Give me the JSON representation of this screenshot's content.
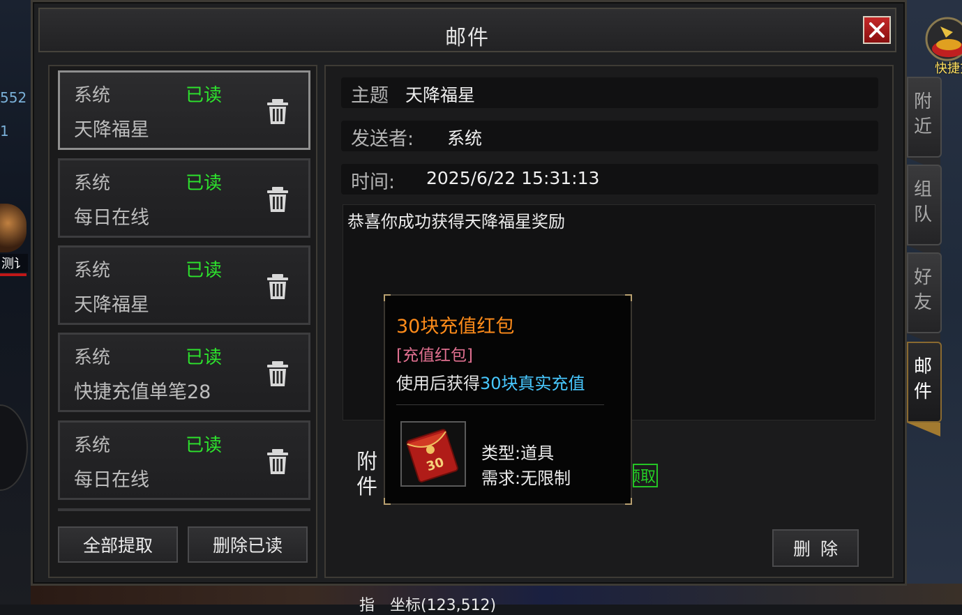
{
  "window": {
    "title": "邮件"
  },
  "left_bg": {
    "num1": "552",
    "num2": "1",
    "name": "测讠"
  },
  "mail_list": [
    {
      "sender": "系统",
      "status": "已读",
      "subject": "天降福星"
    },
    {
      "sender": "系统",
      "status": "已读",
      "subject": "每日在线"
    },
    {
      "sender": "系统",
      "status": "已读",
      "subject": "天降福星"
    },
    {
      "sender": "系统",
      "status": "已读",
      "subject": "快捷充值单笔28"
    },
    {
      "sender": "系统",
      "status": "已读",
      "subject": "每日在线"
    }
  ],
  "buttons": {
    "claim_all": "全部提取",
    "delete_read": "删除已读",
    "delete": "删除",
    "receive": "领取"
  },
  "detail": {
    "subject_label": "主题",
    "subject": "天降福星",
    "sender_label": "发送者:",
    "sender": "系统",
    "time_label": "时间:",
    "time": "2025/6/22 15:31:13",
    "body": "恭喜你成功获得天降福星奖励",
    "attachment_label": "附件"
  },
  "tooltip": {
    "name": "30块充值红包",
    "category": "[充值红包]",
    "desc_prefix": "使用后获得",
    "desc_highlight": "30块真实充值",
    "type": "类型:道具",
    "requirement": "需求:无限制",
    "item_badge": "30"
  },
  "side_tabs": [
    {
      "label": "附近",
      "active": false
    },
    {
      "label": "组队",
      "active": false
    },
    {
      "label": "好友",
      "active": false
    },
    {
      "label": "邮件",
      "active": true
    }
  ],
  "quick_recharge": "快捷充",
  "bottom_chat": "指　坐标(123,512)",
  "colors": {
    "read_status": "#2de32d",
    "item_name": "#ff8c1a",
    "item_category": "#e07090",
    "highlight": "#48c8ff",
    "close_button": "#c42828"
  }
}
